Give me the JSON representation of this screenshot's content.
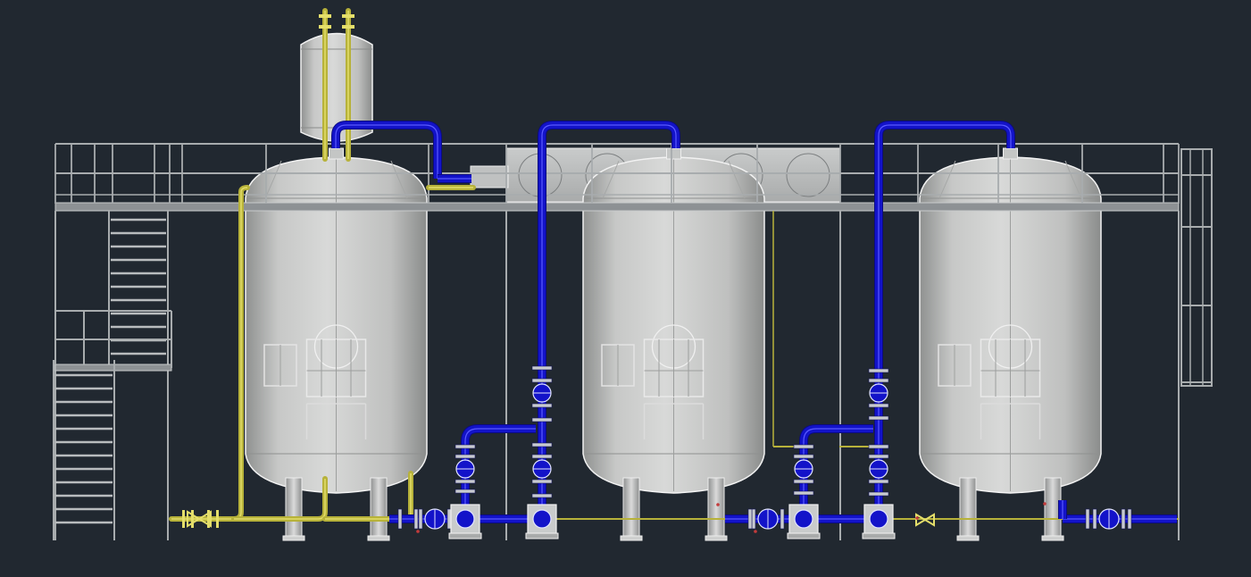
{
  "colors": {
    "background": "#212830",
    "vessel_fill": "#cfd0cf",
    "vessel_shade": "#9fa1a0",
    "vessel_outline": "#f2f2f2",
    "frame_steel": "#a8acae",
    "frame_dark": "#6f7478",
    "process_pipe": "#1313c9",
    "process_pipe_hi": "#5a5aff",
    "utility_pipe": "#b7b23a",
    "utility_pipe_hi": "#e4de6a",
    "flange": "#c8cbd0",
    "marker_red": "#c33b3b"
  },
  "scene": {
    "vessels": [
      {
        "id": "vessel-1",
        "has_overhead_receiver": true
      },
      {
        "id": "vessel-2",
        "has_overhead_receiver": false
      },
      {
        "id": "vessel-3",
        "has_overhead_receiver": false
      }
    ],
    "platform": {
      "has_handrail": true,
      "has_stairs": true,
      "has_side_ladder": true
    },
    "pumps": 4,
    "icons": [
      "valve-icon",
      "flange-icon",
      "pump-icon",
      "manway-icon",
      "stair-icon",
      "ladder-icon"
    ]
  }
}
